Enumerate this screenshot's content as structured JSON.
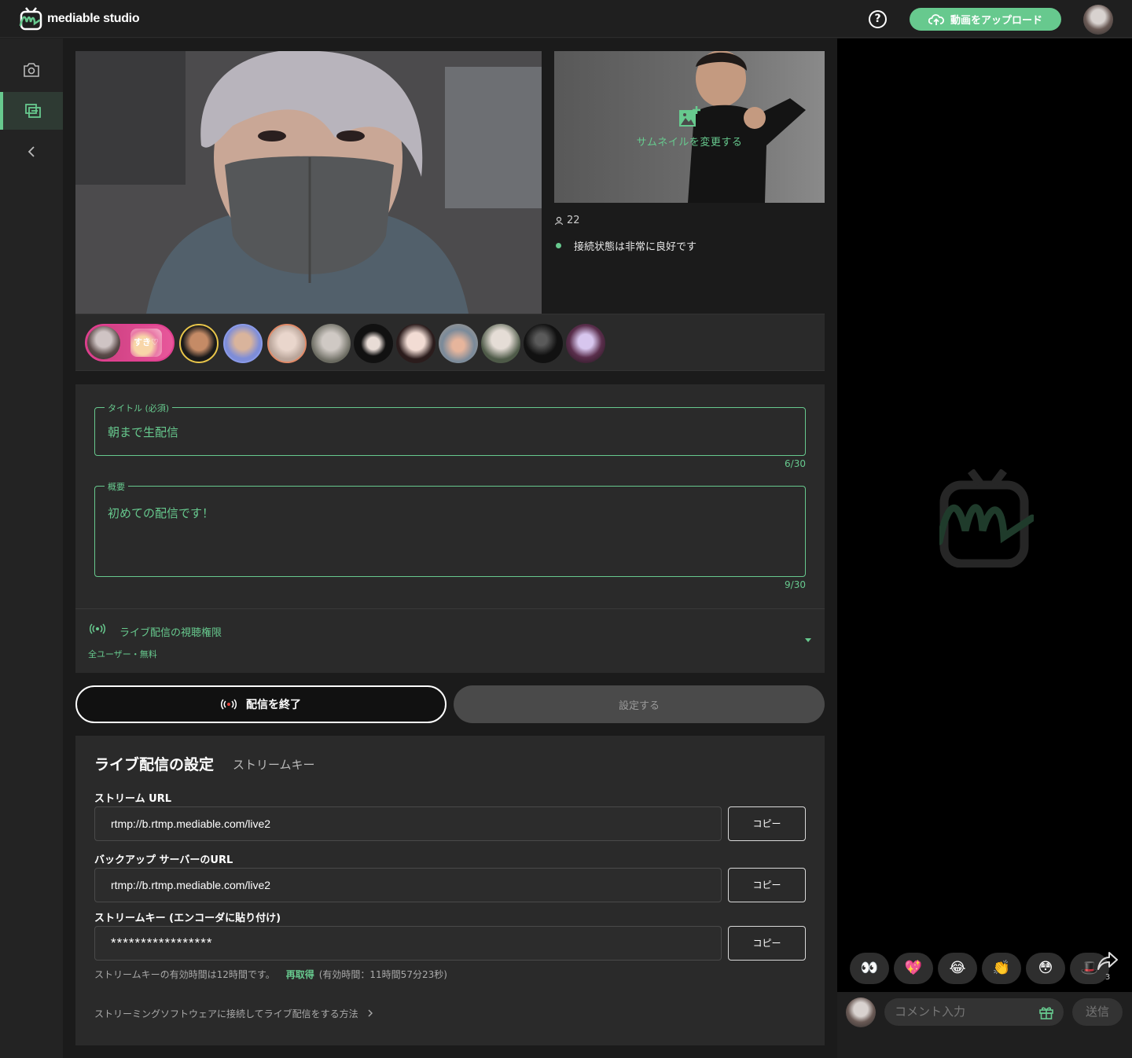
{
  "header": {
    "logo_text": "mediable studio",
    "help_glyph": "?",
    "upload_label": "動画をアップロード"
  },
  "sidebar": {
    "items": [
      {
        "name": "camera-icon"
      },
      {
        "name": "stream-manager-icon",
        "active": true
      },
      {
        "name": "collapse-icon"
      }
    ]
  },
  "stream": {
    "thumbnail_label": "サムネイルを変更する",
    "viewer_count": "22",
    "connection_status": "接続状態は非常に良好です",
    "sticker_text": "すき♡"
  },
  "form": {
    "title_label": "タイトル (必須)",
    "title_value": "朝まで生配信",
    "title_counter": "6/30",
    "summary_label": "概要",
    "summary_value": "初めての配信です！",
    "summary_counter": "9/30",
    "permission_title": "ライブ配信の視聴権限",
    "permission_value": "全ユーザー・無料"
  },
  "actions": {
    "end_label": "配信を終了",
    "settings_label": "設定する"
  },
  "stream_settings": {
    "title": "ライブ配信の設定",
    "tab": "ストリームキー",
    "url_label": "ストリーム URL",
    "url_value": "rtmp://b.rtmp.mediable.com/live2",
    "backup_label": "バックアップ サーバーのURL",
    "backup_value": "rtmp://b.rtmp.mediable.com/live2",
    "key_label": "ストリームキー (エンコーダに貼り付け)",
    "key_value": "*****************",
    "copy_label": "コピー",
    "note": "ストリームキーの有効時間は12時間です。",
    "refresh_label": "再取得",
    "remaining": "(有効時間：11時間57分23秒)",
    "help_link": "ストリーミングソフトウェアに接続してライブ配信をする方法"
  },
  "chat": {
    "reactions": [
      "👀",
      "💖",
      "😂",
      "👏",
      "😳",
      "🎩"
    ],
    "share_count": "3",
    "comment_placeholder": "コメント入力",
    "send_label": "送信"
  },
  "colors": {
    "accent": "#67c98e",
    "background": "#1b1b1b",
    "panel": "#2a2a2a"
  }
}
